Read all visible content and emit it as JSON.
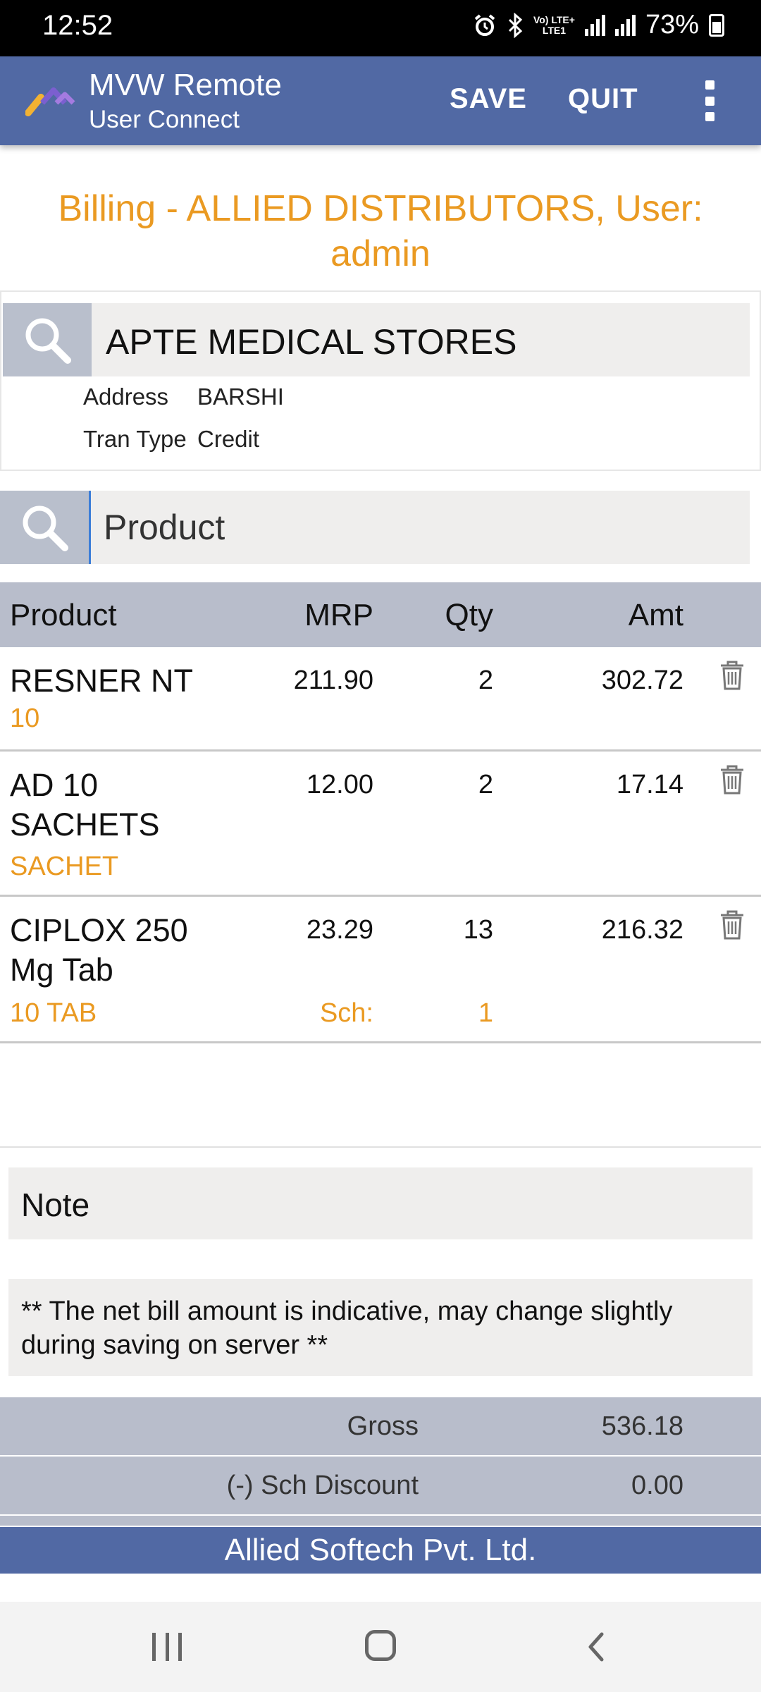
{
  "status_bar": {
    "time": "12:52",
    "network_label_top": "Vo) LTE+",
    "network_label_bottom": "LTE1",
    "battery": "73%",
    "icons": [
      "alarm-icon",
      "bluetooth-icon",
      "signal-icon",
      "signal-icon",
      "battery-icon"
    ]
  },
  "app_bar": {
    "title": "MVW Remote",
    "subtitle": "User Connect",
    "save_label": "SAVE",
    "quit_label": "QUIT",
    "menu_icon": "more-vert-icon"
  },
  "billing": {
    "title": "Billing - ALLIED DISTRIBUTORS, User: admin"
  },
  "customer": {
    "name": "APTE MEDICAL STORES",
    "address_label": "Address",
    "address_value": "BARSHI",
    "tran_type_label": "Tran Type",
    "tran_type_value": "Credit"
  },
  "product_search": {
    "placeholder": "Product"
  },
  "table": {
    "columns": [
      "Product",
      "MRP",
      "Qty",
      "Amt"
    ],
    "rows": [
      {
        "name": "RESNER NT",
        "pack": "10",
        "mrp": "211.90",
        "qty": "2",
        "amt": "302.72"
      },
      {
        "name": "AD 10 SACHETS",
        "pack": "SACHET",
        "mrp": "12.00",
        "qty": "2",
        "amt": "17.14"
      },
      {
        "name": "CIPLOX 250 Mg Tab",
        "pack": "10 TAB",
        "mrp": "23.29",
        "qty": "13",
        "amt": "216.32",
        "sch_label": "Sch:",
        "sch_qty": "1"
      }
    ]
  },
  "note": {
    "placeholder": "Note"
  },
  "notice": "** The net bill amount is indicative, may change slightly during saving on server **",
  "totals": {
    "gross_label": "Gross",
    "gross_value": "536.18",
    "sch_discount_label": "(-) Sch Discount",
    "sch_discount_value": "0.00"
  },
  "footer": "Allied Softech Pvt. Ltd.",
  "colors": {
    "app_bar": "#5169a4",
    "accent_orange": "#ea9a22",
    "table_header": "#b8bdcb",
    "input_bg": "#efeeed"
  }
}
